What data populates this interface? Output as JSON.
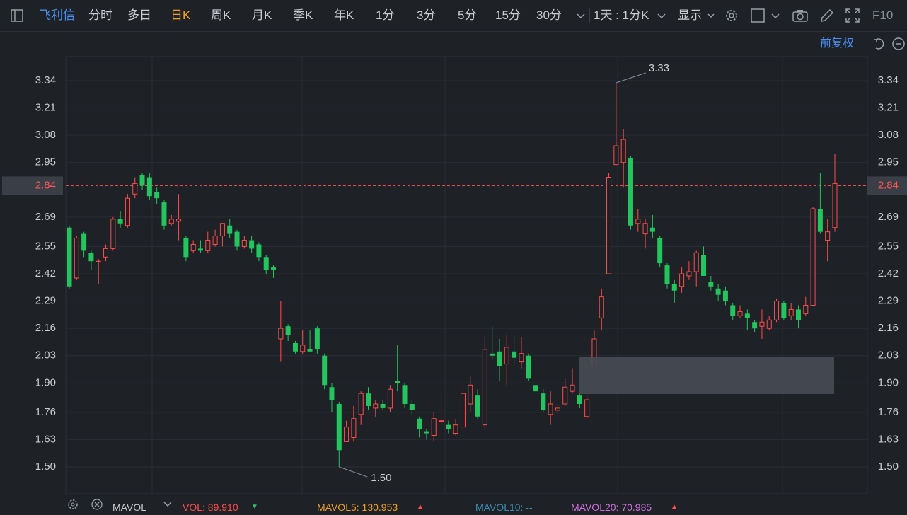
{
  "toolbar": {
    "stock_name": "飞利信",
    "periods": [
      "分时",
      "多日",
      "日K",
      "周K",
      "月K",
      "季K",
      "年K",
      "1分",
      "3分",
      "5分",
      "15分",
      "30分"
    ],
    "active_period": "日K",
    "interval_select": "1天 : 1分K",
    "display_label": "显示",
    "f10_label": "F10",
    "adjust_label": "前复权"
  },
  "chart_data": {
    "type": "candlestick",
    "y_ticks": [
      "3.34",
      "3.21",
      "3.08",
      "2.95",
      "2.84",
      "2.69",
      "2.55",
      "2.42",
      "2.29",
      "2.16",
      "2.03",
      "1.90",
      "1.76",
      "1.63",
      "1.50"
    ],
    "ylim": [
      1.44,
      3.4
    ],
    "grid": true,
    "current_price": 2.84,
    "current_price_label": "2.84",
    "high_label": "3.33",
    "low_label": "1.50",
    "colors": {
      "up": "#ff4d4d",
      "down": "#22c55e",
      "price_line": "#ff5555",
      "grid": "#2a2e34"
    },
    "candles": [
      [
        2.64,
        2.36,
        2.65,
        2.35
      ],
      [
        2.4,
        2.59,
        2.6,
        2.39
      ],
      [
        2.61,
        2.53,
        2.62,
        2.5
      ],
      [
        2.52,
        2.48,
        2.53,
        2.44
      ],
      [
        2.48,
        2.48,
        2.49,
        2.37
      ],
      [
        2.5,
        2.54,
        2.56,
        2.48
      ],
      [
        2.54,
        2.68,
        2.69,
        2.53
      ],
      [
        2.68,
        2.66,
        2.72,
        2.64
      ],
      [
        2.65,
        2.78,
        2.8,
        2.64
      ],
      [
        2.8,
        2.85,
        2.88,
        2.78
      ],
      [
        2.89,
        2.84,
        2.9,
        2.82
      ],
      [
        2.88,
        2.79,
        2.9,
        2.77
      ],
      [
        2.81,
        2.78,
        2.83,
        2.75
      ],
      [
        2.76,
        2.65,
        2.77,
        2.63
      ],
      [
        2.66,
        2.68,
        2.7,
        2.65
      ],
      [
        2.67,
        2.68,
        2.8,
        2.58
      ],
      [
        2.59,
        2.5,
        2.6,
        2.48
      ],
      [
        2.53,
        2.56,
        2.58,
        2.52
      ],
      [
        2.54,
        2.53,
        2.58,
        2.52
      ],
      [
        2.53,
        2.58,
        2.62,
        2.52
      ],
      [
        2.56,
        2.6,
        2.63,
        2.55
      ],
      [
        2.6,
        2.66,
        2.66,
        2.55
      ],
      [
        2.65,
        2.61,
        2.68,
        2.59
      ],
      [
        2.62,
        2.55,
        2.63,
        2.53
      ],
      [
        2.55,
        2.58,
        2.6,
        2.54
      ],
      [
        2.58,
        2.54,
        2.6,
        2.52
      ],
      [
        2.56,
        2.5,
        2.57,
        2.48
      ],
      [
        2.5,
        2.44,
        2.51,
        2.42
      ],
      [
        2.45,
        2.44,
        2.46,
        2.4
      ],
      [
        2.11,
        2.16,
        2.29,
        2.0
      ],
      [
        2.17,
        2.13,
        2.18,
        2.1
      ],
      [
        2.09,
        2.05,
        2.1,
        2.04
      ],
      [
        2.05,
        2.08,
        2.15,
        2.04
      ],
      [
        2.06,
        2.05,
        2.15,
        2.05
      ],
      [
        2.16,
        2.06,
        2.17,
        2.04
      ],
      [
        2.03,
        1.89,
        2.04,
        1.87
      ],
      [
        1.88,
        1.82,
        1.9,
        1.76
      ],
      [
        1.8,
        1.58,
        1.81,
        1.5
      ],
      [
        1.62,
        1.69,
        1.72,
        1.62
      ],
      [
        1.64,
        1.73,
        1.79,
        1.62
      ],
      [
        1.75,
        1.85,
        1.86,
        1.7
      ],
      [
        1.85,
        1.79,
        1.88,
        1.77
      ],
      [
        1.78,
        1.8,
        1.82,
        1.74
      ],
      [
        1.8,
        1.78,
        1.82,
        1.77
      ],
      [
        1.78,
        1.87,
        1.89,
        1.76
      ],
      [
        1.91,
        1.9,
        2.08,
        1.86
      ],
      [
        1.89,
        1.8,
        1.9,
        1.78
      ],
      [
        1.8,
        1.77,
        1.82,
        1.75
      ],
      [
        1.73,
        1.68,
        1.74,
        1.64
      ],
      [
        1.67,
        1.66,
        1.68,
        1.63
      ],
      [
        1.65,
        1.73,
        1.76,
        1.62
      ],
      [
        1.72,
        1.72,
        1.85,
        1.7
      ],
      [
        1.7,
        1.68,
        1.72,
        1.66
      ],
      [
        1.66,
        1.7,
        1.73,
        1.65
      ],
      [
        1.69,
        1.85,
        1.9,
        1.68
      ],
      [
        1.8,
        1.89,
        1.93,
        1.76
      ],
      [
        1.84,
        1.74,
        1.87,
        1.73
      ],
      [
        1.7,
        2.06,
        2.12,
        1.68
      ],
      [
        2.04,
        2.03,
        2.17,
        2.01
      ],
      [
        2.05,
        1.98,
        2.11,
        1.91
      ],
      [
        1.99,
        2.07,
        2.13,
        1.89
      ],
      [
        2.05,
        2.02,
        2.13,
        1.98
      ],
      [
        2.0,
        2.04,
        2.12,
        1.97
      ],
      [
        2.03,
        1.92,
        2.04,
        1.91
      ],
      [
        1.89,
        1.86,
        1.91,
        1.85
      ],
      [
        1.85,
        1.77,
        1.87,
        1.76
      ],
      [
        1.75,
        1.8,
        1.86,
        1.7
      ],
      [
        1.77,
        1.78,
        1.8,
        1.75
      ],
      [
        1.8,
        1.88,
        1.92,
        1.79
      ],
      [
        1.86,
        1.89,
        1.97,
        1.85
      ],
      [
        1.84,
        1.8,
        1.85,
        1.78
      ],
      [
        1.74,
        1.82,
        1.85,
        1.73
      ],
      [
        1.98,
        2.11,
        2.15,
        1.99
      ],
      [
        2.21,
        2.31,
        2.35,
        2.15
      ],
      [
        2.42,
        2.88,
        2.9,
        2.42
      ],
      [
        2.94,
        3.03,
        3.33,
        2.94
      ],
      [
        2.95,
        3.06,
        3.11,
        2.83
      ],
      [
        2.97,
        2.65,
        2.98,
        2.63
      ],
      [
        2.66,
        2.68,
        2.73,
        2.62
      ],
      [
        2.61,
        2.66,
        2.68,
        2.54
      ],
      [
        2.64,
        2.62,
        2.7,
        2.59
      ],
      [
        2.59,
        2.47,
        2.6,
        2.45
      ],
      [
        2.46,
        2.37,
        2.47,
        2.35
      ],
      [
        2.37,
        2.34,
        2.39,
        2.28
      ],
      [
        2.36,
        2.42,
        2.45,
        2.33
      ],
      [
        2.41,
        2.43,
        2.48,
        2.39
      ],
      [
        2.43,
        2.52,
        2.53,
        2.36
      ],
      [
        2.51,
        2.41,
        2.55,
        2.41
      ],
      [
        2.38,
        2.36,
        2.41,
        2.34
      ],
      [
        2.35,
        2.32,
        2.37,
        2.29
      ],
      [
        2.34,
        2.29,
        2.36,
        2.27
      ],
      [
        2.27,
        2.22,
        2.28,
        2.2
      ],
      [
        2.22,
        2.24,
        2.27,
        2.21
      ],
      [
        2.23,
        2.21,
        2.25,
        2.15
      ],
      [
        2.19,
        2.16,
        2.2,
        2.14
      ],
      [
        2.17,
        2.19,
        2.25,
        2.11
      ],
      [
        2.16,
        2.2,
        2.22,
        2.15
      ],
      [
        2.2,
        2.29,
        2.3,
        2.19
      ],
      [
        2.28,
        2.21,
        2.29,
        2.2
      ],
      [
        2.22,
        2.25,
        2.28,
        2.2
      ],
      [
        2.25,
        2.2,
        2.27,
        2.16
      ],
      [
        2.23,
        2.27,
        2.31,
        2.22
      ],
      [
        2.27,
        2.73,
        2.74,
        2.27
      ],
      [
        2.73,
        2.62,
        2.9,
        2.61
      ],
      [
        2.58,
        2.62,
        2.68,
        2.48
      ],
      [
        2.64,
        2.85,
        2.99,
        2.62
      ]
    ]
  },
  "indicator_bar": {
    "name": "MAVOL",
    "vol": "VOL: 89.910",
    "mavol5": "MAVOL5: 130.953",
    "mavol10": "MAVOL10: --",
    "mavol20": "MAVOL20: 70.985"
  }
}
